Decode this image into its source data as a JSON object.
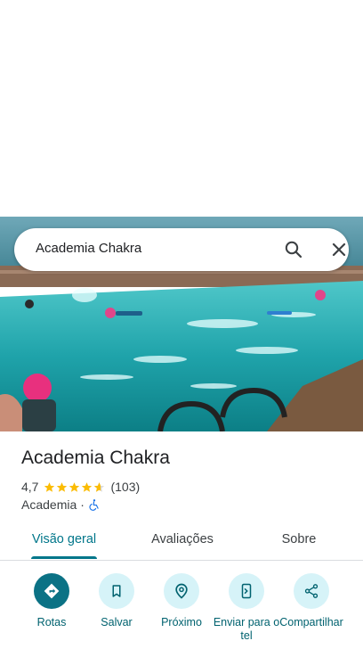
{
  "search": {
    "query": "Academia Chakra",
    "search_icon": "search-icon",
    "close_icon": "close-icon"
  },
  "place": {
    "name": "Academia Chakra",
    "rating": "4,7",
    "rating_value": 4.7,
    "reviews_count": "(103)",
    "category": "Academia",
    "category_separator": "·",
    "accessibility_icon": "wheelchair-icon"
  },
  "tabs": [
    {
      "label": "Visão geral",
      "active": true
    },
    {
      "label": "Avaliações",
      "active": false
    },
    {
      "label": "Sobre",
      "active": false
    }
  ],
  "actions": [
    {
      "label": "Rotas",
      "icon": "directions-icon"
    },
    {
      "label": "Salvar",
      "icon": "bookmark-icon"
    },
    {
      "label": "Próximo",
      "icon": "nearby-icon"
    },
    {
      "label": "Enviar para o tel",
      "icon": "send-to-phone-icon"
    },
    {
      "label": "Compartilhar",
      "icon": "share-icon"
    }
  ],
  "colors": {
    "accent": "#00768a",
    "star": "#fbbc04",
    "action_bg": "#d6f3f8",
    "primary_action_bg": "#0b7285"
  }
}
